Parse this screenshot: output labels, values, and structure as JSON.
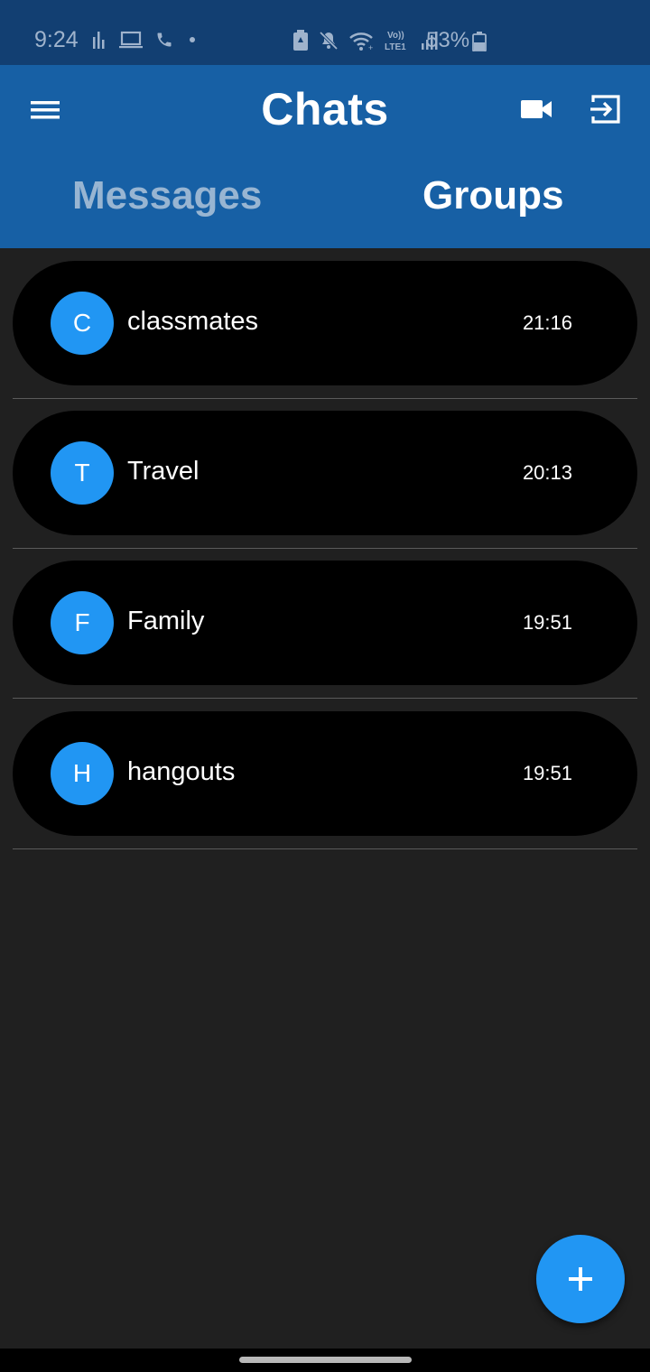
{
  "status_bar": {
    "time": "9:24",
    "battery": "53%",
    "icons_left": [
      "activity-icon",
      "laptop-icon",
      "phone-icon",
      "dot-icon"
    ],
    "icons_right": [
      "battery-saver-icon",
      "mute-icon",
      "wifi-icon",
      "volte-icon",
      "signal-icon"
    ]
  },
  "app_bar": {
    "title": "Chats",
    "menu_icon": "hamburger-menu-icon",
    "video_icon": "video-camera-icon",
    "logout_icon": "exit-icon"
  },
  "tabs": [
    {
      "label": "Messages",
      "active": false
    },
    {
      "label": "Groups",
      "active": true
    }
  ],
  "chats": [
    {
      "initial": "C",
      "name": "classmates",
      "time": "21:16"
    },
    {
      "initial": "T",
      "name": "Travel",
      "time": "20:13"
    },
    {
      "initial": "F",
      "name": "Family",
      "time": "19:51"
    },
    {
      "initial": "H",
      "name": "hangouts",
      "time": "19:51"
    }
  ],
  "fab": {
    "icon": "plus-icon"
  },
  "colors": {
    "app_bar": "#1760a5",
    "status_bar": "#123f72",
    "background": "#202020",
    "accent": "#2196f3",
    "tab_inactive": "#98b5d2"
  }
}
